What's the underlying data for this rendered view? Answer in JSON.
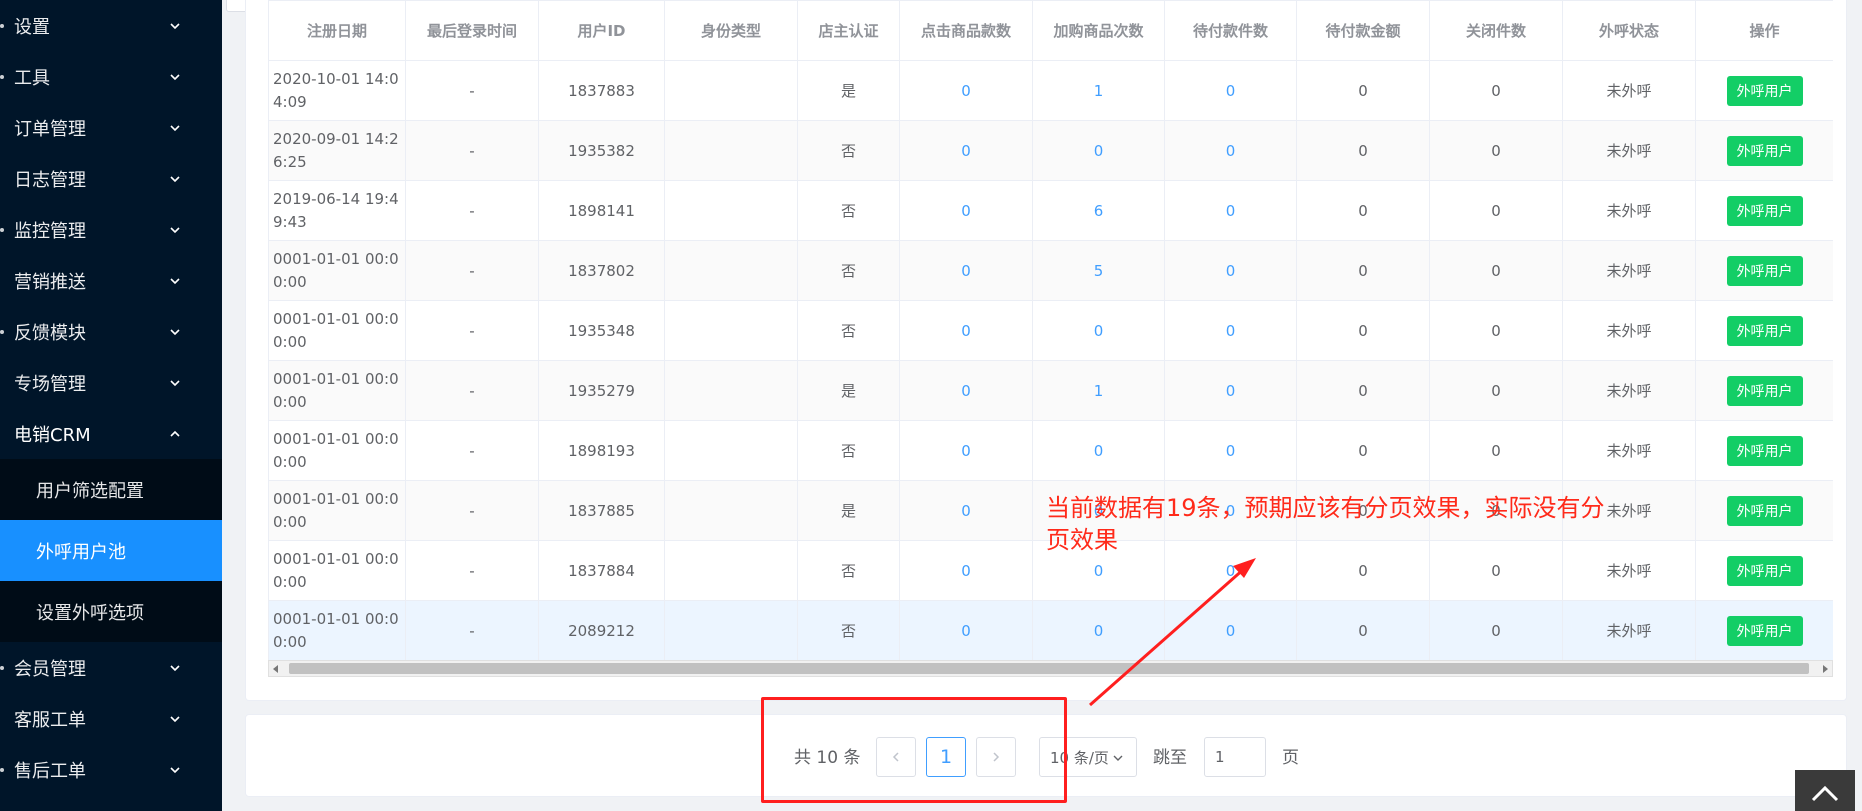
{
  "sidebar": {
    "items": [
      {
        "label": "设置"
      },
      {
        "label": "工具"
      },
      {
        "label": "订单管理"
      },
      {
        "label": "日志管理"
      },
      {
        "label": "监控管理"
      },
      {
        "label": "营销推送"
      },
      {
        "label": "反馈模块"
      },
      {
        "label": "专场管理"
      },
      {
        "label": "电销CRM"
      },
      {
        "label": "会员管理"
      },
      {
        "label": "客服工单"
      },
      {
        "label": "售后工单"
      }
    ],
    "submenu": [
      {
        "label": "用户筛选配置"
      },
      {
        "label": "外呼用户池"
      },
      {
        "label": "设置外呼选项"
      }
    ]
  },
  "table": {
    "headers": [
      "注册日期",
      "最后登录时间",
      "用户ID",
      "身份类型",
      "店主认证",
      "点击商品款数",
      "加购商品次数",
      "待付款件数",
      "待付款金额",
      "关闭件数",
      "外呼状态",
      "操作"
    ],
    "action_label": "外呼用户",
    "rows": [
      {
        "date": "2020-10-01 14:04:09",
        "last_login": "-",
        "user_id": "1837883",
        "identity": "",
        "verified": "是",
        "clicks": "0",
        "cart_adds": "1",
        "unpaid_items": "0",
        "unpaid_amount": "0",
        "closed": "0",
        "call_status": "未外呼"
      },
      {
        "date": "2020-09-01 14:26:25",
        "last_login": "-",
        "user_id": "1935382",
        "identity": "",
        "verified": "否",
        "clicks": "0",
        "cart_adds": "0",
        "unpaid_items": "0",
        "unpaid_amount": "0",
        "closed": "0",
        "call_status": "未外呼"
      },
      {
        "date": "2019-06-14 19:49:43",
        "last_login": "-",
        "user_id": "1898141",
        "identity": "",
        "verified": "否",
        "clicks": "0",
        "cart_adds": "6",
        "unpaid_items": "0",
        "unpaid_amount": "0",
        "closed": "0",
        "call_status": "未外呼"
      },
      {
        "date": "0001-01-01 00:00:00",
        "last_login": "-",
        "user_id": "1837802",
        "identity": "",
        "verified": "否",
        "clicks": "0",
        "cart_adds": "5",
        "unpaid_items": "0",
        "unpaid_amount": "0",
        "closed": "0",
        "call_status": "未外呼"
      },
      {
        "date": "0001-01-01 00:00:00",
        "last_login": "-",
        "user_id": "1935348",
        "identity": "",
        "verified": "否",
        "clicks": "0",
        "cart_adds": "0",
        "unpaid_items": "0",
        "unpaid_amount": "0",
        "closed": "0",
        "call_status": "未外呼"
      },
      {
        "date": "0001-01-01 00:00:00",
        "last_login": "-",
        "user_id": "1935279",
        "identity": "",
        "verified": "是",
        "clicks": "0",
        "cart_adds": "1",
        "unpaid_items": "0",
        "unpaid_amount": "0",
        "closed": "0",
        "call_status": "未外呼"
      },
      {
        "date": "0001-01-01 00:00:00",
        "last_login": "-",
        "user_id": "1898193",
        "identity": "",
        "verified": "否",
        "clicks": "0",
        "cart_adds": "0",
        "unpaid_items": "0",
        "unpaid_amount": "0",
        "closed": "0",
        "call_status": "未外呼"
      },
      {
        "date": "0001-01-01 00:00:00",
        "last_login": "-",
        "user_id": "1837885",
        "identity": "",
        "verified": "是",
        "clicks": "0",
        "cart_adds": "0",
        "unpaid_items": "0",
        "unpaid_amount": "0",
        "closed": "0",
        "call_status": "未外呼"
      },
      {
        "date": "0001-01-01 00:00:00",
        "last_login": "-",
        "user_id": "1837884",
        "identity": "",
        "verified": "否",
        "clicks": "0",
        "cart_adds": "0",
        "unpaid_items": "0",
        "unpaid_amount": "0",
        "closed": "0",
        "call_status": "未外呼"
      },
      {
        "date": "0001-01-01 00:00:00",
        "last_login": "-",
        "user_id": "2089212",
        "identity": "",
        "verified": "否",
        "clicks": "0",
        "cart_adds": "0",
        "unpaid_items": "0",
        "unpaid_amount": "0",
        "closed": "0",
        "call_status": "未外呼"
      }
    ]
  },
  "pagination": {
    "total_label": "共 10 条",
    "current_page": "1",
    "page_size_label": "10 条/页",
    "jump_label": "跳至",
    "jump_value": "1",
    "page_suffix": "页"
  },
  "annotation": {
    "text": "当前数据有19条，预期应该有分页效果，实际没有分页效果"
  },
  "colors": {
    "sidebar_bg": "#001529",
    "active": "#1890ff",
    "link": "#409eff",
    "success": "#13ce66",
    "annotation": "#ff1f1f"
  }
}
